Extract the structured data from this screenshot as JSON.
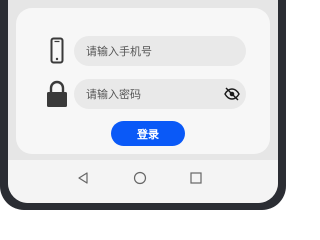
{
  "login_form": {
    "phone_placeholder": "请输入手机号",
    "password_placeholder": "请输入密码",
    "login_label": "登录"
  },
  "icons": {
    "phone": "phone-icon",
    "lock": "lock-icon",
    "eye": "eye-off-icon",
    "back": "triangle-back-icon",
    "home": "circle-home-icon",
    "recents": "square-recents-icon"
  },
  "colors": {
    "accent": "#0a59f7",
    "card": "#f7f7f7",
    "input_bg": "#e9e9e9",
    "bezel": "#2b2d33"
  }
}
